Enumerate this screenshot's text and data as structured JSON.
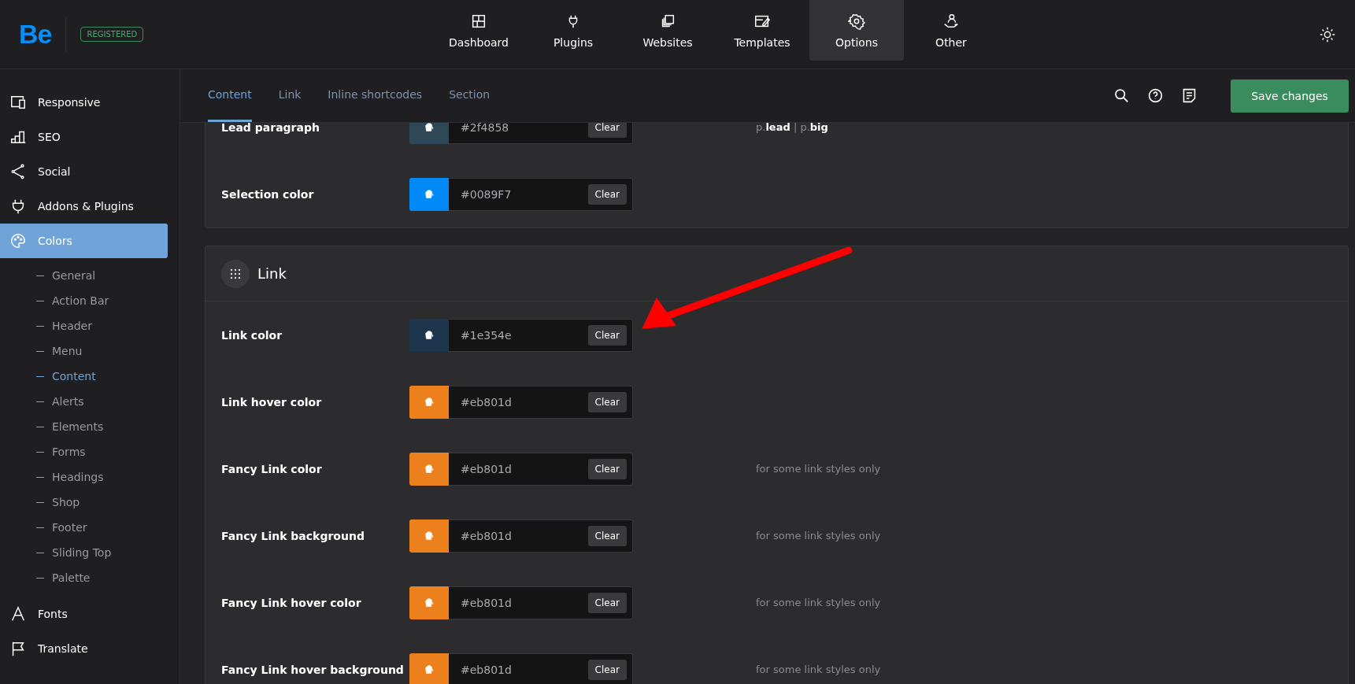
{
  "header": {
    "logo": "Be",
    "badge": "REGISTERED",
    "nav": [
      {
        "label": "Dashboard",
        "selected": false
      },
      {
        "label": "Plugins",
        "selected": false
      },
      {
        "label": "Websites",
        "selected": false
      },
      {
        "label": "Templates",
        "selected": false
      },
      {
        "label": "Options",
        "selected": true
      },
      {
        "label": "Other",
        "selected": false
      }
    ]
  },
  "sidebar": {
    "items": [
      {
        "label": "Responsive",
        "selected": false
      },
      {
        "label": "SEO",
        "selected": false
      },
      {
        "label": "Social",
        "selected": false
      },
      {
        "label": "Addons & Plugins",
        "selected": false
      },
      {
        "label": "Colors",
        "selected": true,
        "children": [
          {
            "label": "General",
            "selected": false
          },
          {
            "label": "Action Bar",
            "selected": false
          },
          {
            "label": "Header",
            "selected": false
          },
          {
            "label": "Menu",
            "selected": false
          },
          {
            "label": "Content",
            "selected": true
          },
          {
            "label": "Alerts",
            "selected": false
          },
          {
            "label": "Elements",
            "selected": false
          },
          {
            "label": "Forms",
            "selected": false
          },
          {
            "label": "Headings",
            "selected": false
          },
          {
            "label": "Shop",
            "selected": false
          },
          {
            "label": "Footer",
            "selected": false
          },
          {
            "label": "Sliding Top",
            "selected": false
          },
          {
            "label": "Palette",
            "selected": false
          }
        ]
      },
      {
        "label": "Fonts",
        "selected": false
      },
      {
        "label": "Translate",
        "selected": false
      }
    ]
  },
  "tabs": [
    {
      "label": "Content",
      "selected": true
    },
    {
      "label": "Link",
      "selected": false
    },
    {
      "label": "Inline shortcodes",
      "selected": false
    },
    {
      "label": "Section",
      "selected": false
    }
  ],
  "save_button": "Save changes",
  "sections": [
    {
      "rows": [
        {
          "label": "Lead paragraph",
          "color": "#2f4858",
          "value": "#2f4858",
          "clear": "Clear",
          "note": "p.**lead** | p.**big**"
        },
        {
          "label": "Selection color",
          "color": "#0089f7",
          "value": "#0089F7",
          "clear": "Clear"
        }
      ]
    },
    {
      "title": "Link",
      "rows": [
        {
          "label": "Link color",
          "color": "#1e354e",
          "value": "#1e354e",
          "clear": "Clear"
        },
        {
          "label": "Link hover color",
          "color": "#eb801d",
          "value": "#eb801d",
          "clear": "Clear"
        },
        {
          "label": "Fancy Link color",
          "color": "#eb801d",
          "value": "#eb801d",
          "clear": "Clear",
          "note": "for some link styles only"
        },
        {
          "label": "Fancy Link background",
          "color": "#eb801d",
          "value": "#eb801d",
          "clear": "Clear",
          "note": "for some link styles only"
        },
        {
          "label": "Fancy Link hover color",
          "color": "#eb801d",
          "value": "#eb801d",
          "clear": "Clear",
          "note": "for some link styles only"
        },
        {
          "label": "Fancy Link hover background",
          "color": "#eb801d",
          "value": "#eb801d",
          "clear": "Clear",
          "note": "for some link styles only"
        }
      ]
    }
  ]
}
